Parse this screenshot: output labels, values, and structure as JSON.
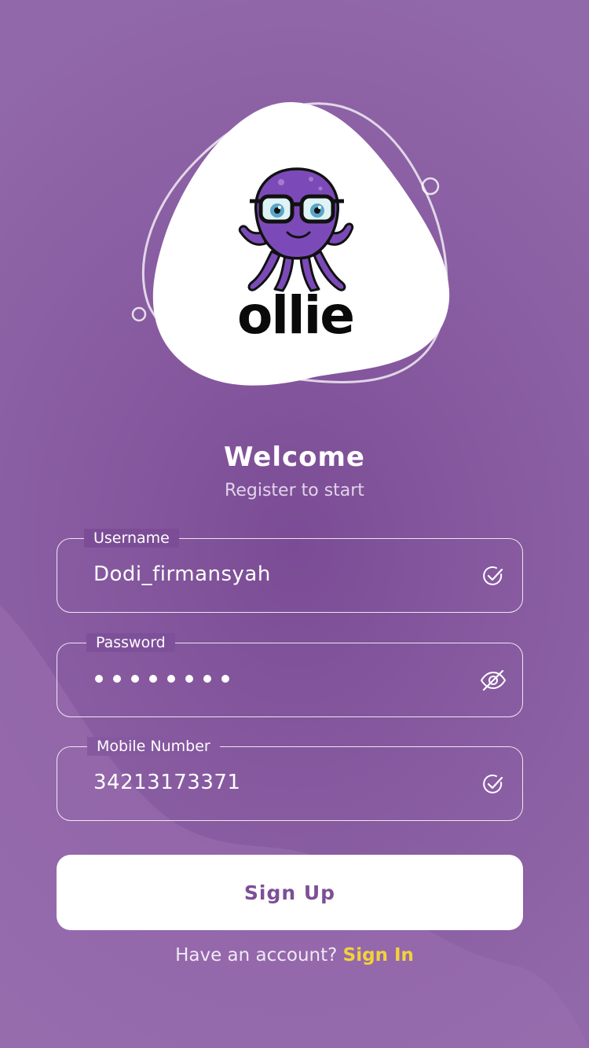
{
  "brand": {
    "name": "ollie"
  },
  "header": {
    "title": "Welcome",
    "subtitle": "Register to start"
  },
  "form": {
    "username": {
      "label": "Username",
      "value": "Dodi_firmansyah",
      "status_icon": "check-circle-icon"
    },
    "password": {
      "label": "Password",
      "masked_length": 8,
      "toggle_icon": "eye-off-icon"
    },
    "mobile": {
      "label": "Mobile Number",
      "value": "34213173371",
      "status_icon": "check-circle-icon"
    }
  },
  "actions": {
    "signup_label": "Sign Up",
    "signin_prompt": "Have an account?",
    "signin_link": "Sign In"
  },
  "colors": {
    "background": "#875aa0",
    "accent_text": "#7d4f95",
    "link": "#f3d23a",
    "octopus": "#7c4ab8"
  }
}
